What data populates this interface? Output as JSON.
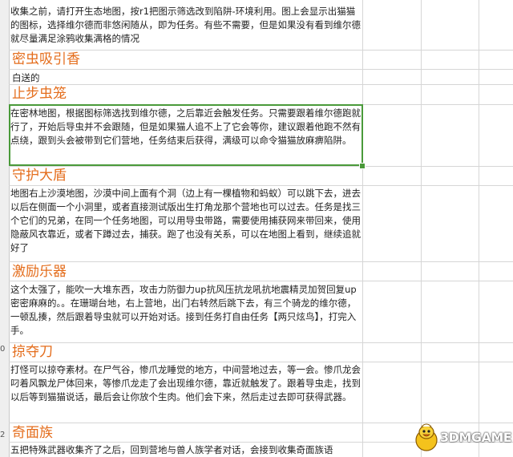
{
  "row_numbers": [
    "0",
    "2"
  ],
  "rows": [
    {
      "id": "r0",
      "text": "收集之前，请打开生态地图，按r1把图示筛选改到陷阱-环境利用。图上会显示出猫猫的图标，选择维尔德而非悠闲随从，即为任务。有些不需要，但是如果没有看到维尔德就尽量满足涂鸦收集满格的情况"
    },
    {
      "id": "h1",
      "heading": "密虫吸引香"
    },
    {
      "id": "r1",
      "text": "白送的"
    },
    {
      "id": "h2",
      "heading": "止步虫笼"
    },
    {
      "id": "r2",
      "text": "在密林地图，根据图标筛选找到维尔德，之后靠近会触发任务。只需要跟着维尔德跑就行了，开始后导虫并不会跟随，但是如果猫人追不上了它会等你，建议跟着他跑不然有点绕，跟到头会被带到它们营地，任务结束后获得，满级可以命令猫猫放麻痹陷阱。"
    },
    {
      "id": "h3",
      "heading": "守护大盾"
    },
    {
      "id": "r3",
      "text": "地图右上沙漠地图，沙漠中间上面有个洞（边上有一棵植物和蚂蚁）可以跳下去，进去以后在侧面一个小洞里，或者直接测试版出生打角龙那个营地也可以过去。任务是找三个它们的兄弟，在同一个任务地图，可以用导虫带路，需要使用捕获网来带回来，使用隐蔽风衣靠近，或者下蹲过去，捕获。跑了也没有关系，可以在地图上看到，继续追就好了"
    },
    {
      "id": "h4",
      "heading": "激励乐器"
    },
    {
      "id": "r4",
      "text": "这个太强了，能吹一大堆东西，攻击力防御力up抗风压抗龙吼抗地震精灵加贺回复up密密麻麻的。。在珊瑚台地，右上营地，出门右转然后跳下去，有三个骑龙的维尔德，一顿乱揍，然后跟着导虫就可以开始对话。接到任务打自由任务【两只炫鸟】，打完入手。"
    },
    {
      "id": "h5",
      "heading": "掠夺刀"
    },
    {
      "id": "r5",
      "text": "打怪可以掠夺素材。在尸气谷，惨爪龙睡觉的地方，中间营地过去，等一会。惨爪龙会叼着风飘龙尸体回来，等惨爪龙走了会出现维尔德，靠近就触发了。跟着导虫走，找到以后等到猫猫说话，最后会让你放个生肉。他们会下来，然后走过去即可获得武器。"
    },
    {
      "id": "h6",
      "heading": "奇面族"
    },
    {
      "id": "r6",
      "text": "五把特殊武器收集齐了之后，回到营地与兽人族学者对话，会接到收集奇面族语"
    }
  ],
  "watermark": {
    "logo_text": "3DMGAME",
    "icon": "duck-mascot-icon"
  }
}
